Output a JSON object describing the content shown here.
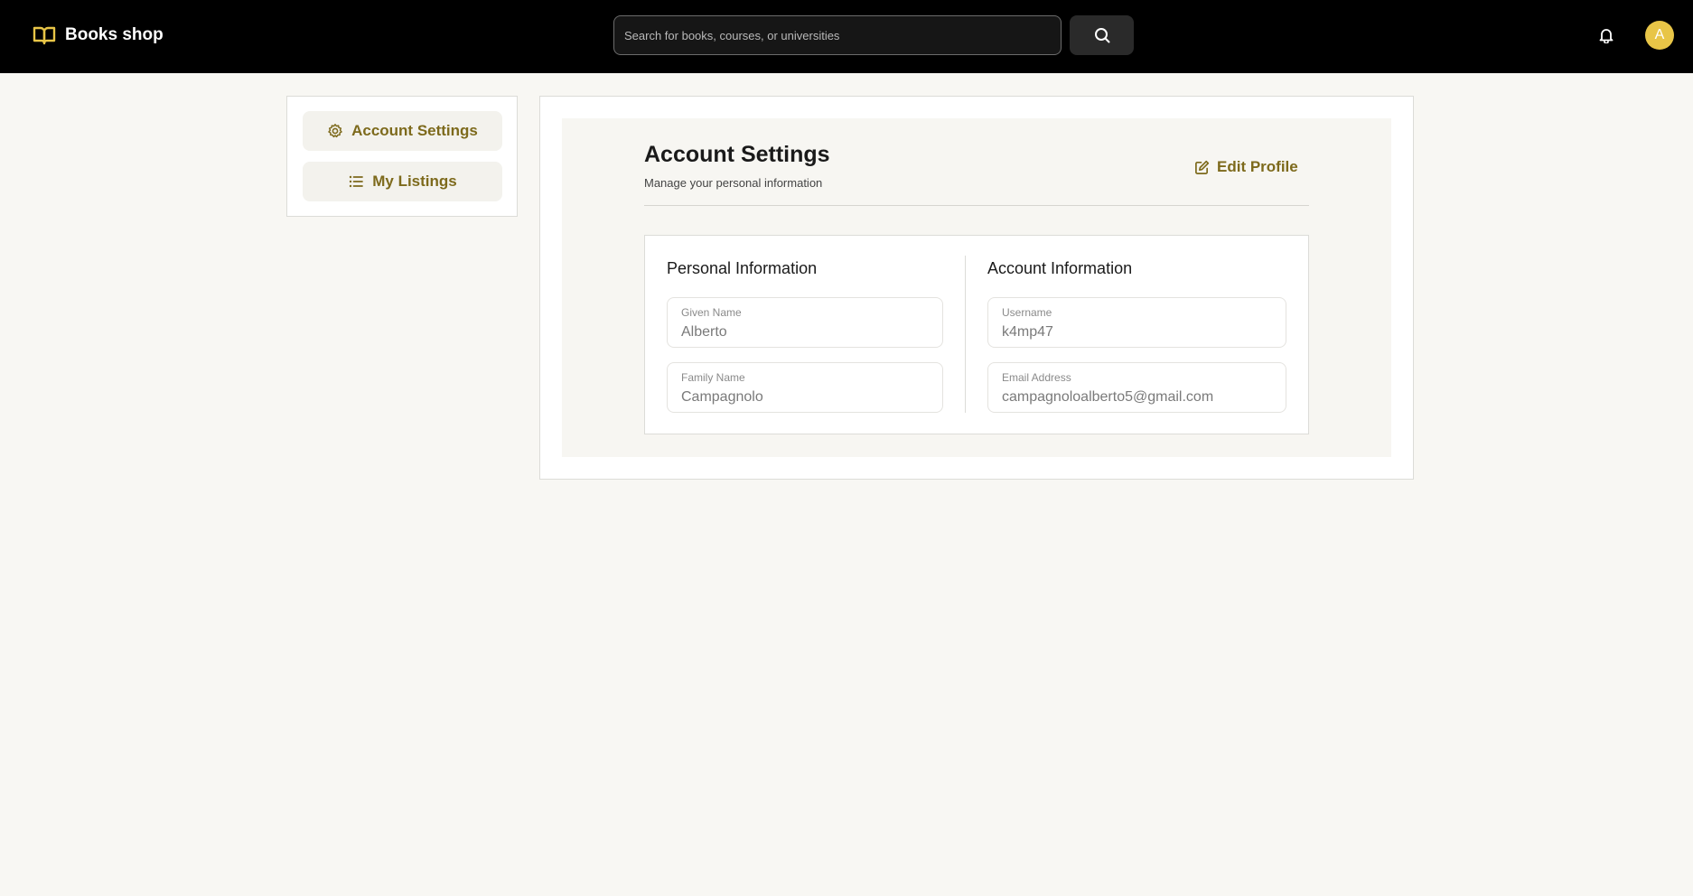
{
  "header": {
    "brand_name": "Books shop",
    "brand_icon": "book-open-icon",
    "search_placeholder": "Search for books, courses, or universities",
    "search_icon": "search-icon",
    "notification_icon": "bell-icon",
    "avatar_initial": "A",
    "colors": {
      "background": "#000000",
      "accent": "#e8c547"
    }
  },
  "sidebar": {
    "items": [
      {
        "label": "Account Settings",
        "icon": "gear-icon"
      },
      {
        "label": "My Listings",
        "icon": "list-icon"
      }
    ],
    "accent": "#7d6a1c"
  },
  "main": {
    "title": "Account Settings",
    "subtitle": "Manage your personal information",
    "edit_label": "Edit Profile",
    "edit_icon": "edit-icon",
    "personal": {
      "title": "Personal Information",
      "fields": [
        {
          "label": "Given Name",
          "value": "Alberto"
        },
        {
          "label": "Family Name",
          "value": "Campagnolo"
        }
      ]
    },
    "account": {
      "title": "Account Information",
      "fields": [
        {
          "label": "Username",
          "value": "k4mp47"
        },
        {
          "label": "Email Address",
          "value": "campagnoloalberto5@gmail.com"
        }
      ]
    }
  }
}
